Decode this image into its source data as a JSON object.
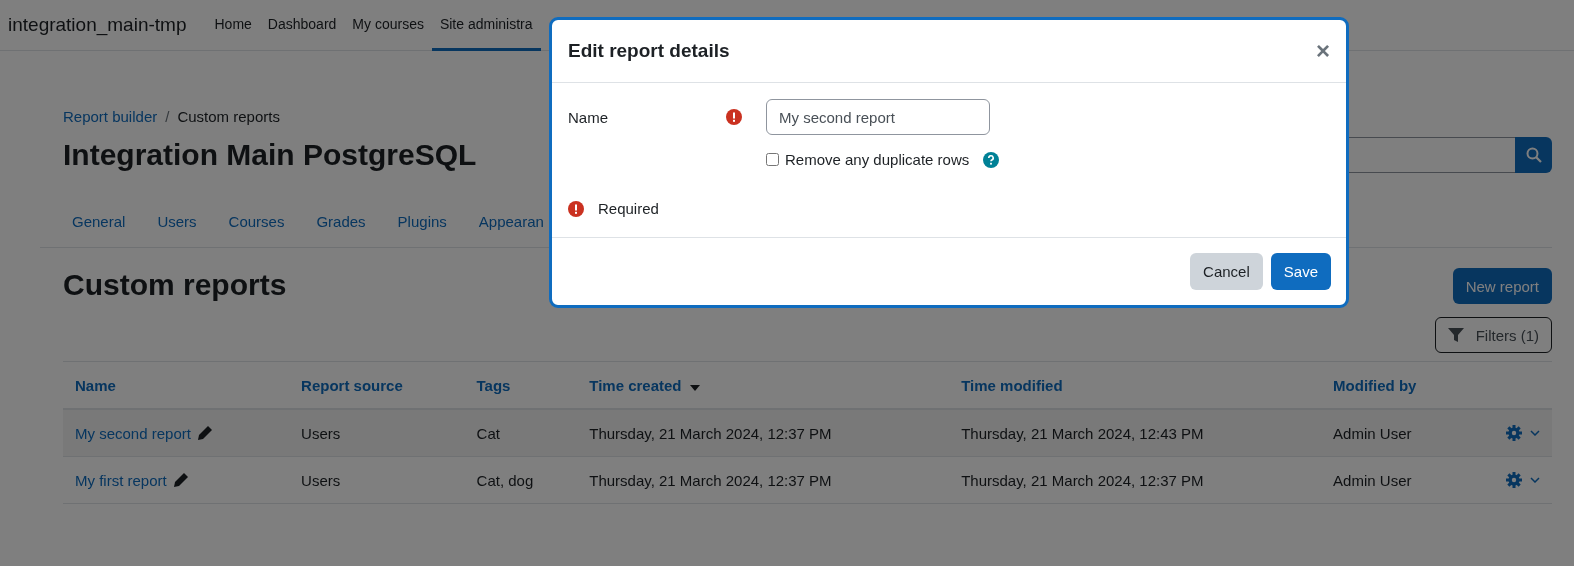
{
  "navbar": {
    "brand": "integration_main-tmp",
    "items": [
      {
        "label": "Home",
        "selected": false
      },
      {
        "label": "Dashboard",
        "selected": false
      },
      {
        "label": "My courses",
        "selected": false
      },
      {
        "label": "Site administra",
        "selected": true
      }
    ]
  },
  "breadcrumb": [
    {
      "label": "Report builder",
      "kind": "link"
    },
    {
      "label": "/",
      "kind": "separator"
    },
    {
      "label": "Custom reports",
      "kind": "current"
    }
  ],
  "page_title": "Integration Main PostgreSQL",
  "secondary_nav": [
    "General",
    "Users",
    "Courses",
    "Grades",
    "Plugins",
    "Appearan"
  ],
  "heading": "Custom reports",
  "new_button": "New report",
  "filters_button": "Filters (1)",
  "table": {
    "columns": [
      {
        "label": "Name",
        "sorted": false
      },
      {
        "label": "Report source",
        "sorted": false
      },
      {
        "label": "Tags",
        "sorted": false
      },
      {
        "label": "Time created",
        "sorted": true
      },
      {
        "label": "Time modified",
        "sorted": false
      },
      {
        "label": "Modified by",
        "sorted": false
      }
    ],
    "rows": [
      {
        "highlighted": true,
        "cells": [
          "My second report",
          "Users",
          "Cat",
          "Thursday, 21 March 2024, 12:37 PM",
          "Thursday, 21 March 2024, 12:43 PM",
          "Admin User"
        ]
      },
      {
        "highlighted": false,
        "cells": [
          "My first report",
          "Users",
          "Cat, dog",
          "Thursday, 21 March 2024, 12:37 PM",
          "Thursday, 21 March 2024, 12:37 PM",
          "Admin User"
        ]
      }
    ]
  },
  "modal": {
    "title": "Edit report details",
    "close": "×",
    "name_label": "Name",
    "name_value": "My second report",
    "name_required": true,
    "checkbox": {
      "label": "Remove any duplicate rows",
      "checked": false
    },
    "error": "Required",
    "buttons": [
      {
        "label": "Cancel",
        "kind": "secondary"
      },
      {
        "label": "Save",
        "kind": "primary"
      }
    ]
  }
}
